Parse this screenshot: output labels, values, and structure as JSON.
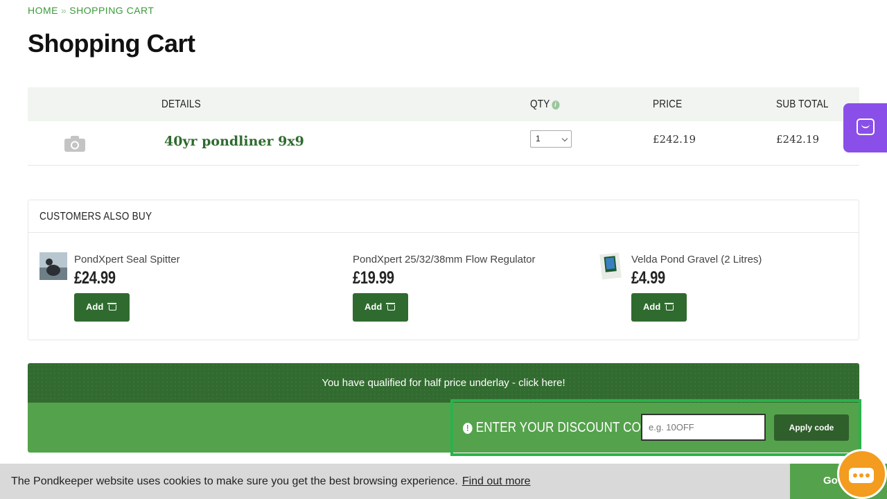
{
  "breadcrumb": {
    "home": "HOME",
    "separator": "»",
    "current": "SHOPPING CART"
  },
  "page_title": "Shopping Cart",
  "cart": {
    "headers": {
      "details": "DETAILS",
      "qty": "QTY",
      "qty_info_icon": "info-icon",
      "price": "PRICE",
      "subtotal": "SUB TOTAL"
    },
    "items": [
      {
        "image_icon": "camera-icon",
        "name": "40yr pondliner 9x9",
        "qty": "1",
        "price": "£242.19",
        "subtotal": "£242.19"
      }
    ]
  },
  "customers_also_buy": {
    "title": "CUSTOMERS ALSO BUY",
    "products": [
      {
        "name": "PondXpert Seal Spitter",
        "price": "£24.99",
        "button": "Add"
      },
      {
        "name": "PondXpert 25/32/38mm Flow Regulator",
        "price": "£19.99",
        "button": "Add"
      },
      {
        "name": "Velda Pond Gravel (2 Litres)",
        "price": "£4.99",
        "button": "Add"
      }
    ]
  },
  "promo": {
    "text": "You have qualified for half price underlay - click here!"
  },
  "discount": {
    "label": "ENTER YOUR DISCOUNT CODE",
    "placeholder": "e.g. 10OFF",
    "button": "Apply code"
  },
  "cookie": {
    "text": "The Pondkeeper website uses cookies to make sure you get the best browsing experience.",
    "link": "Find out more",
    "button": "Go"
  },
  "colors": {
    "brand_green": "#2f6b2f",
    "light_green": "#55a24c",
    "highlight": "#2bb24c",
    "chat_purple": "#8a4fe8",
    "chat_orange": "#f39c1f"
  }
}
